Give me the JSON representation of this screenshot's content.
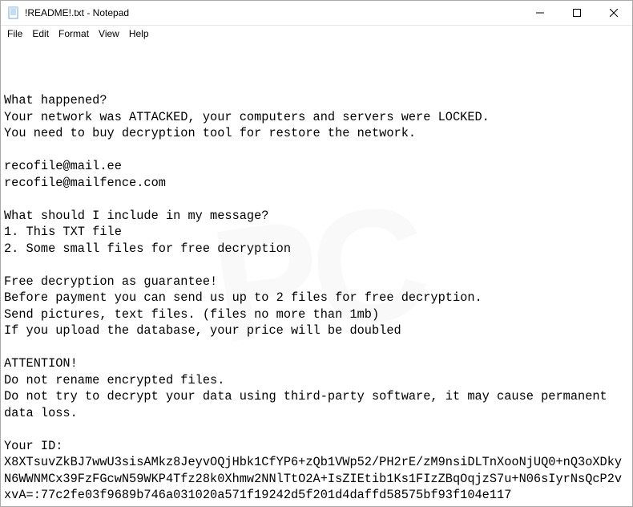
{
  "titlebar": {
    "title": "!README!.txt - Notepad"
  },
  "menu": {
    "file": "File",
    "edit": "Edit",
    "format": "Format",
    "view": "View",
    "help": "Help"
  },
  "content": {
    "text": "What happened?\nYour network was ATTACKED, your computers and servers were LOCKED.\nYou need to buy decryption tool for restore the network.\n\nrecofile@mail.ee\nrecofile@mailfence.com\n\nWhat should I include in my message?\n1. This TXT file\n2. Some small files for free decryption\n\nFree decryption as guarantee!\nBefore payment you can send us up to 2 files for free decryption.\nSend pictures, text files. (files no more than 1mb)\nIf you upload the database, your price will be doubled\n\nATTENTION!\nDo not rename encrypted files.\nDo not try to decrypt your data using third-party software, it may cause permanent data loss.\n\nYour ID:\nX8XTsuvZkBJ7wwU3sisAMkz8JeyvOQjHbk1CfYP6+zQb1VWp52/PH2rE/zM9nsiDLTnXooNjUQ0+nQ3oXDkyN6WWNMCx39FzFGcwN59WKP4Tfz28k0Xhmw2NNlTtO2A+IsZIEtib1Ks1FIzZBqOqjzS7u+N06sIyrNsQcP2vxvA=:77c2fe03f9689b746a031020a571f19242d5f201d4daffd58575bf93f104e117"
  }
}
